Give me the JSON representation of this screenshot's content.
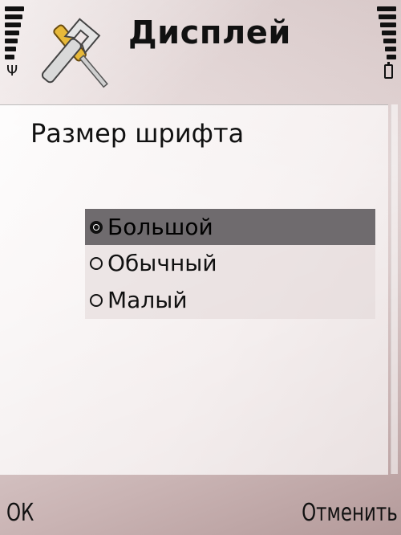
{
  "header": {
    "title": "Дисплей",
    "app_icon": "wrench-settings-icon",
    "signal_icon": "antenna-icon",
    "battery_icon": "battery-icon"
  },
  "panel": {
    "title": "Размер шрифта"
  },
  "options": [
    {
      "label": "Большой",
      "selected": true
    },
    {
      "label": "Обычный",
      "selected": false
    },
    {
      "label": "Малый",
      "selected": false
    }
  ],
  "softkeys": {
    "left": "ОК",
    "right": "Отменить"
  },
  "colors": {
    "selection": "#6f6b6e",
    "text": "#111111"
  }
}
